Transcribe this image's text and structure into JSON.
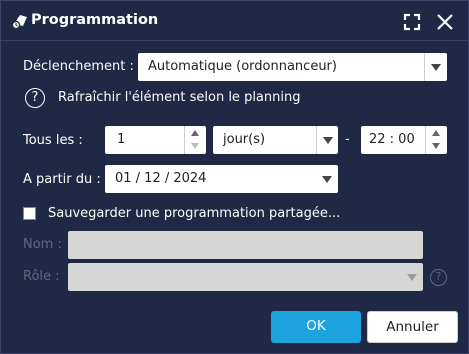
{
  "dialog": {
    "title": "Programmation",
    "expand_icon": "expand-icon",
    "close_icon": "close-icon"
  },
  "trigger": {
    "label": "Déclenchement :",
    "value": "Automatique (ordonnanceur)"
  },
  "help": {
    "icon": "?",
    "text": "Rafraîchir l'élément selon le planning"
  },
  "every": {
    "label": "Tous les :",
    "count": "1",
    "unit": "jour(s)",
    "separator": "-",
    "time": "22 : 00"
  },
  "start": {
    "label": "A partir du :",
    "date": "01 / 12 / 2024"
  },
  "shared": {
    "label": "Sauvegarder une programmation partagée...",
    "checked": false
  },
  "name": {
    "label": "Nom :",
    "value": ""
  },
  "role": {
    "label": "Rôle :",
    "value": "",
    "help": "?"
  },
  "buttons": {
    "ok": "OK",
    "cancel": "Annuler"
  },
  "colors": {
    "background": "#1f2844",
    "primary": "#1ca3e0",
    "disabled_text": "#5f6884"
  }
}
